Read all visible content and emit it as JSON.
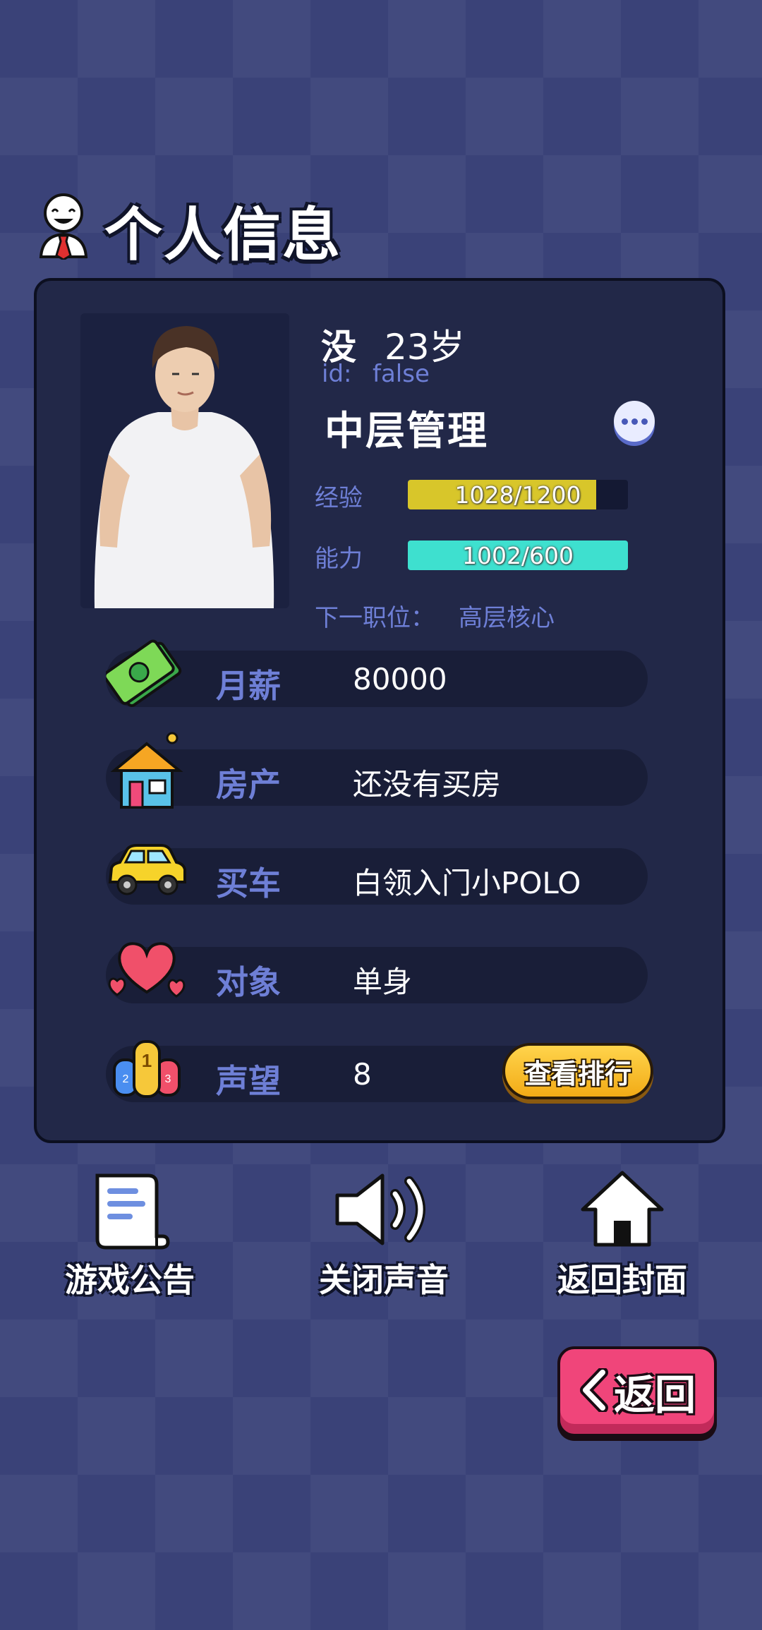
{
  "header": {
    "title": "个人信息",
    "icon": "businessman-icon"
  },
  "profile": {
    "name": "没",
    "age": "23岁",
    "id_label": "id:",
    "id_value": "false",
    "position": "中层管理",
    "more_icon": "more-icon"
  },
  "stats": {
    "exp": {
      "label": "经验",
      "text": "1028/1200",
      "progress": 0.857,
      "color": "#d8c62a"
    },
    "ability": {
      "label": "能力",
      "text": "1002/600",
      "progress": 1.0,
      "color": "#3ee0cf"
    }
  },
  "next_position": {
    "label": "下一职位：",
    "value": "高层核心"
  },
  "rows": [
    {
      "icon": "money-icon",
      "label": "月薪",
      "value": "80000"
    },
    {
      "icon": "house-icon",
      "label": "房产",
      "value": "还没有买房"
    },
    {
      "icon": "car-icon",
      "label": "买车",
      "value": "白领入门小POLO"
    },
    {
      "icon": "heart-icon",
      "label": "对象",
      "value": "单身"
    },
    {
      "icon": "medal-icon",
      "label": "声望",
      "value": "8"
    }
  ],
  "rank_button": "查看排行",
  "bottom_nav": [
    {
      "icon": "notice-icon",
      "label": "游戏公告"
    },
    {
      "icon": "speaker-icon",
      "label": "关闭声音"
    },
    {
      "icon": "home-icon",
      "label": "返回封面"
    }
  ],
  "back_button": {
    "label": "返回",
    "icon": "chevron-left-icon"
  },
  "colors": {
    "background": "#3a4278",
    "panel": "#222848",
    "accent_text": "#6e7fd6",
    "back_button": "#f0457a"
  }
}
